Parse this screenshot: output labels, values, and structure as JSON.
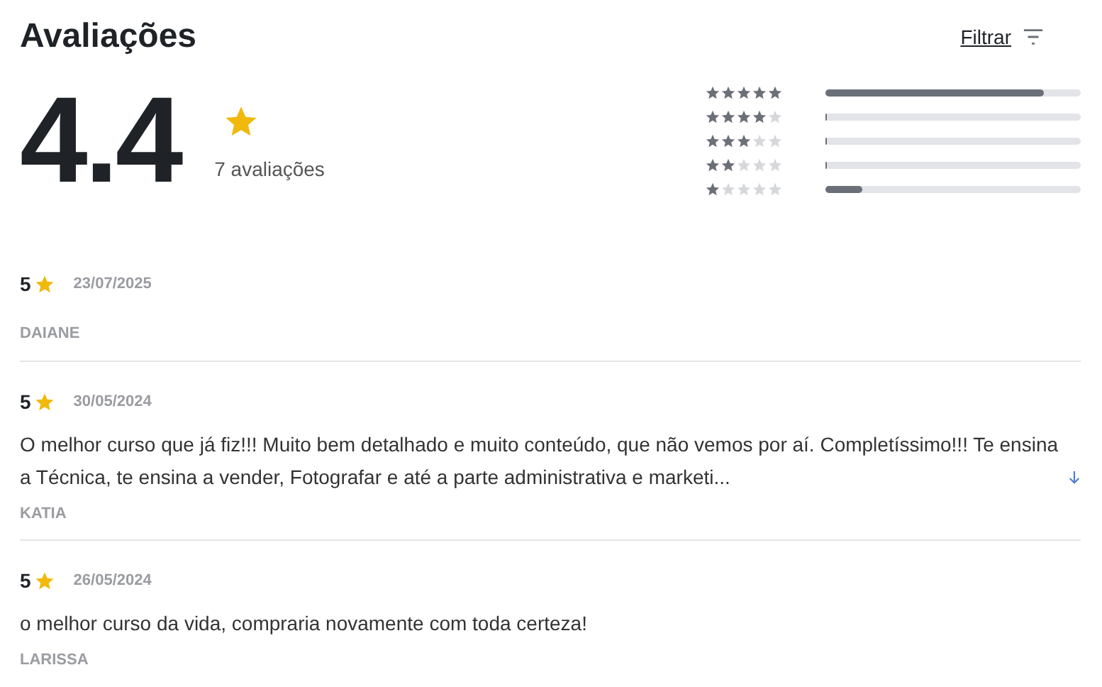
{
  "title": "Avaliações",
  "filter": {
    "label": "Filtrar"
  },
  "summary": {
    "average": "4.4",
    "count": "7 avaliações"
  },
  "distribution": [
    {
      "stars": 5,
      "level": 0.857
    },
    {
      "stars": 4,
      "level": 0
    },
    {
      "stars": 3,
      "level": 0
    },
    {
      "stars": 2,
      "level": 0
    },
    {
      "stars": 1,
      "level": 0.143
    }
  ],
  "reviews": [
    {
      "rating": "5",
      "date": "23/07/2025",
      "author": "DAIANE"
    },
    {
      "rating": "5",
      "date": "30/05/2024",
      "text": "O melhor curso que já fiz!!! Muito bem detalhado e muito conteúdo, que não vemos por aí. Completíssimo!!! Te ensina a Técnica, te ensina a vender, Fotografar e até a parte administrativa e marketi...",
      "expandable": true,
      "author": "KATIA"
    },
    {
      "rating": "5",
      "date": "26/05/2024",
      "text": "o melhor curso da vida, compraria novamente com toda certeza!",
      "author": "LARISSA"
    }
  ]
}
